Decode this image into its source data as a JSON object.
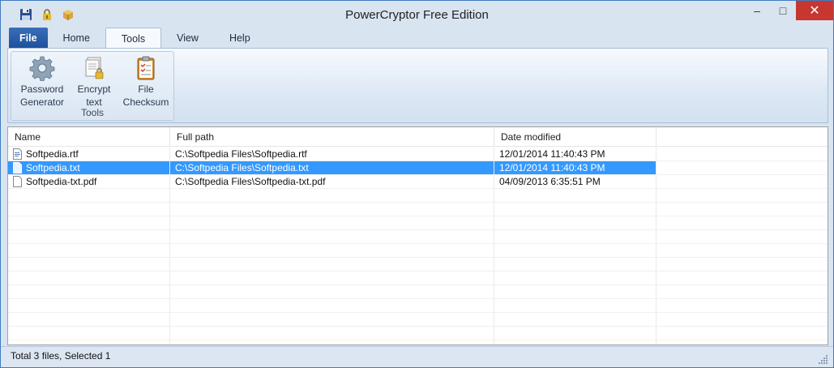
{
  "window": {
    "title": "PowerCryptor Free Edition"
  },
  "qat": [
    {
      "icon": "floppy-disk-icon"
    },
    {
      "icon": "lock-icon"
    },
    {
      "icon": "box-icon"
    }
  ],
  "window_controls": {
    "minimize": "–",
    "maximize": "□",
    "close": "✕"
  },
  "tabs": [
    {
      "label": "File"
    },
    {
      "label": "Home"
    },
    {
      "label": "Tools"
    },
    {
      "label": "View"
    },
    {
      "label": "Help"
    }
  ],
  "active_tab": "Tools",
  "ribbon": {
    "group_label": "Tools",
    "buttons": [
      {
        "label_line1": "Password",
        "label_line2": "Generator",
        "icon": "gear-icon"
      },
      {
        "label_line1": "Encrypt",
        "label_line2": "text",
        "icon": "document-stack-icon"
      },
      {
        "label_line1": "File",
        "label_line2": "Checksum",
        "icon": "clipboard-checklist-icon"
      }
    ]
  },
  "list": {
    "columns": [
      "Name",
      "Full path",
      "Date modified"
    ],
    "rows": [
      {
        "name": "Softpedia.rtf",
        "path": "C:\\Softpedia Files\\Softpedia.rtf",
        "date": "12/01/2014 11:40:43 PM",
        "selected": false
      },
      {
        "name": "Softpedia.txt",
        "path": "C:\\Softpedia Files\\Softpedia.txt",
        "date": "12/01/2014 11:40:43 PM",
        "selected": true
      },
      {
        "name": "Softpedia-txt.pdf",
        "path": "C:\\Softpedia Files\\Softpedia-txt.pdf",
        "date": "04/09/2013 6:35:51 PM",
        "selected": false
      }
    ]
  },
  "status": {
    "text": "Total 3 files, Selected 1"
  },
  "colors": {
    "selection": "#3399ff",
    "file_tab": "#2a5fab",
    "close_button": "#c7372f"
  }
}
